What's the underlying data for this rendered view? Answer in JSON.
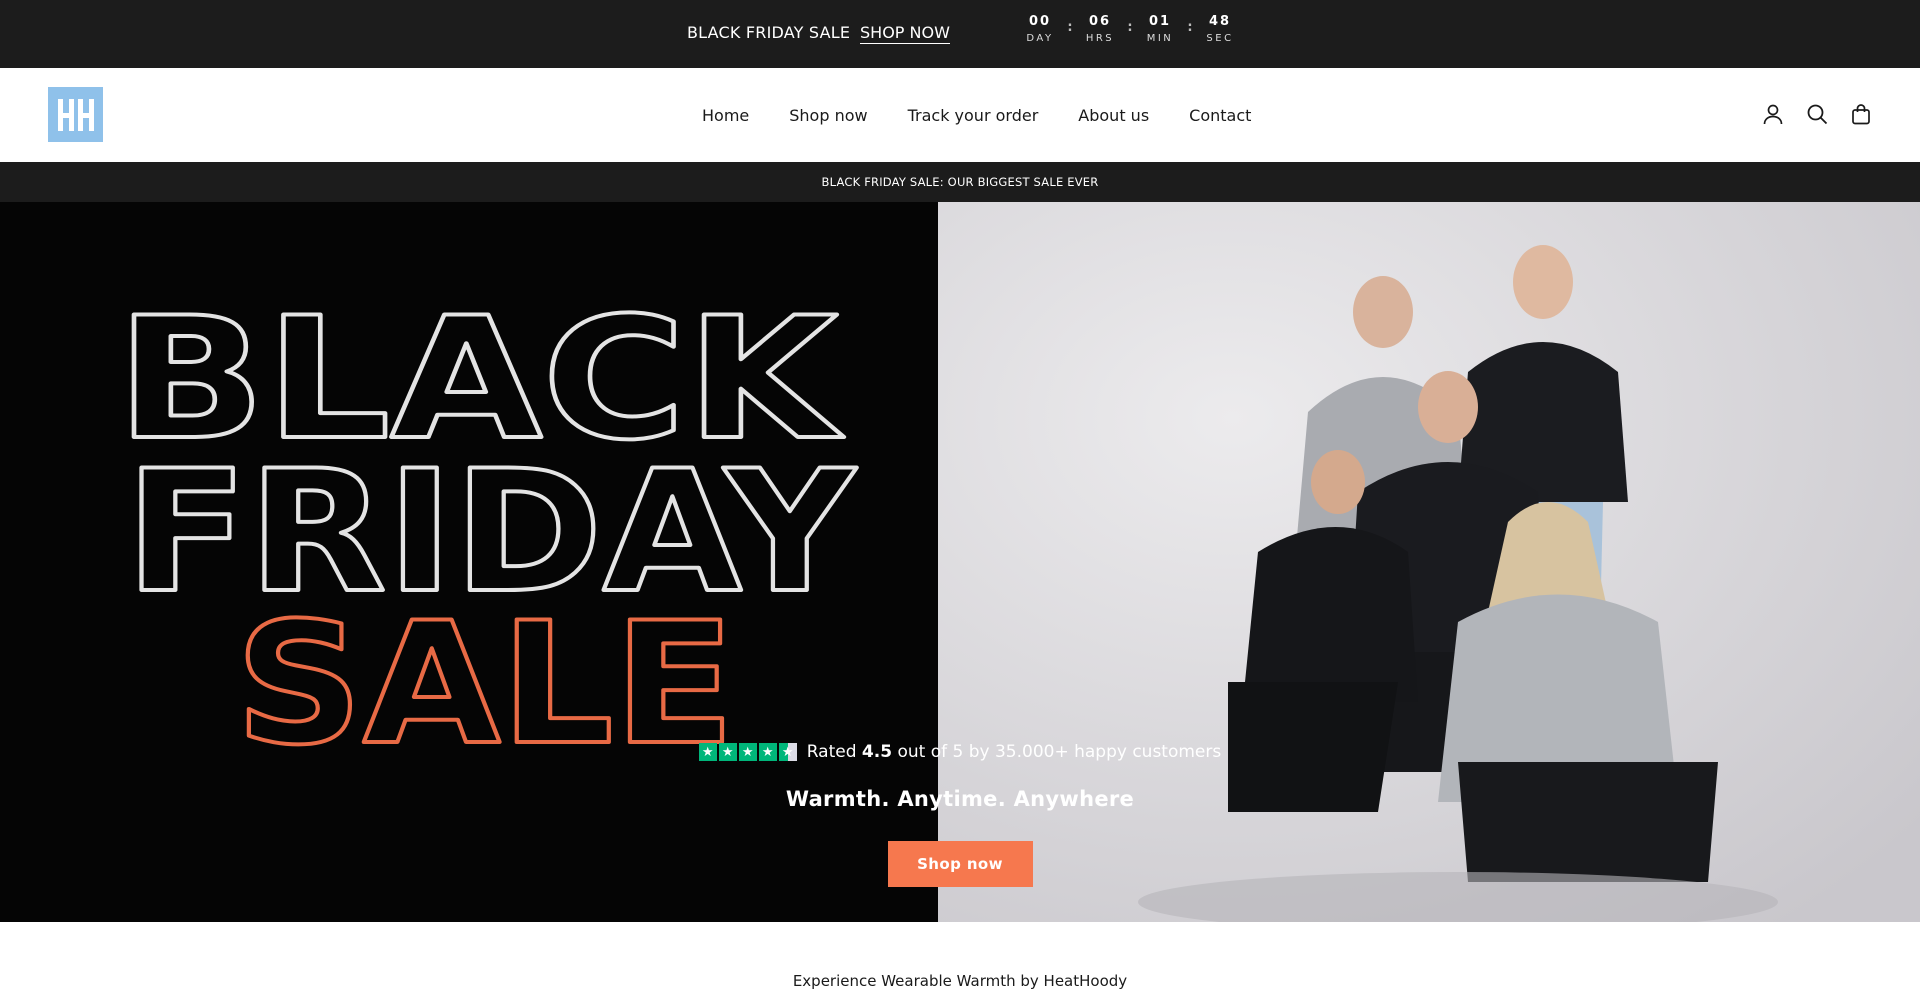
{
  "topbar": {
    "sale_label": "BLACK FRIDAY SALE",
    "shop_link": "SHOP NOW",
    "countdown": [
      {
        "value": "00",
        "label": "DAY"
      },
      {
        "value": "06",
        "label": "HRS"
      },
      {
        "value": "01",
        "label": "MIN"
      },
      {
        "value": "48",
        "label": "SEC"
      }
    ],
    "separator": ":"
  },
  "header": {
    "logo_text": "HH",
    "nav": [
      "Home",
      "Shop now",
      "Track your order",
      "About us",
      "Contact"
    ],
    "icons": [
      "account-icon",
      "search-icon",
      "cart-icon"
    ]
  },
  "announcement": "BLACK FRIDAY SALE: OUR BIGGEST SALE EVER",
  "hero": {
    "headline_line1": "BLACK",
    "headline_line2": "FRIDAY",
    "headline_line3": "SALE",
    "rating_prefix": "Rated",
    "rating_value": "4.5",
    "rating_suffix": "out of 5 by 35.000+ happy customers",
    "rating_stars": 4.5,
    "tagline": "Warmth. Anytime. Anywhere",
    "button_label": "Shop now",
    "colors": {
      "accent": "#f6784e",
      "sale_outline": "#e86a45",
      "star_green": "#00b67a"
    }
  },
  "below": {
    "text": "Experience Wearable Warmth by HeatHoody"
  }
}
